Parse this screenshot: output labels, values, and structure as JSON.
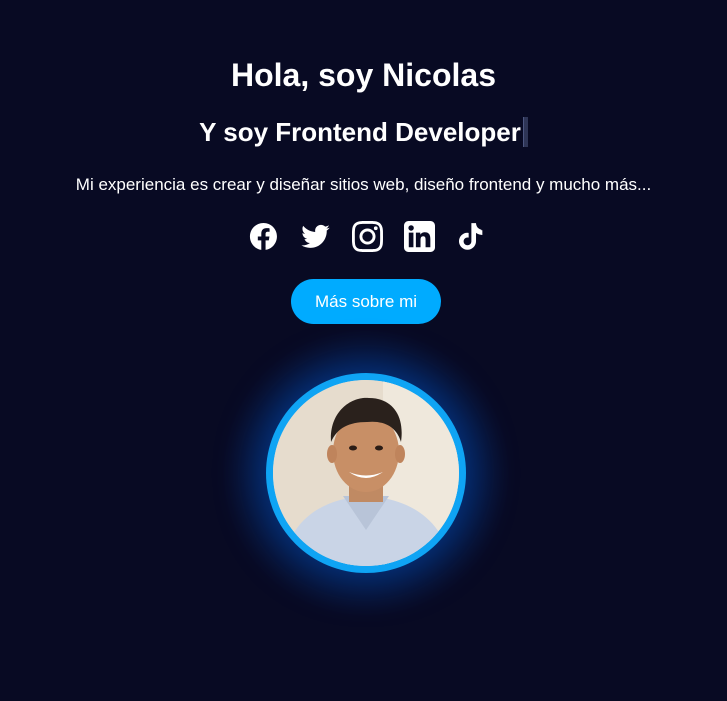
{
  "hero": {
    "greeting": "Hola, soy Nicolas",
    "role": "Y soy Frontend Developer",
    "bio": "Mi experiencia es crear y diseñar sitios web, diseño frontend y mucho más...",
    "cta_label": "Más sobre mi"
  },
  "socials": [
    {
      "name": "facebook",
      "icon": "facebook-icon"
    },
    {
      "name": "twitter",
      "icon": "twitter-icon"
    },
    {
      "name": "instagram",
      "icon": "instagram-icon"
    },
    {
      "name": "linkedin",
      "icon": "linkedin-icon"
    },
    {
      "name": "tiktok",
      "icon": "tiktok-icon"
    }
  ],
  "colors": {
    "background": "#080a23",
    "accent": "#00abff",
    "ring": "#0fa4f4",
    "text": "#ffffff"
  }
}
